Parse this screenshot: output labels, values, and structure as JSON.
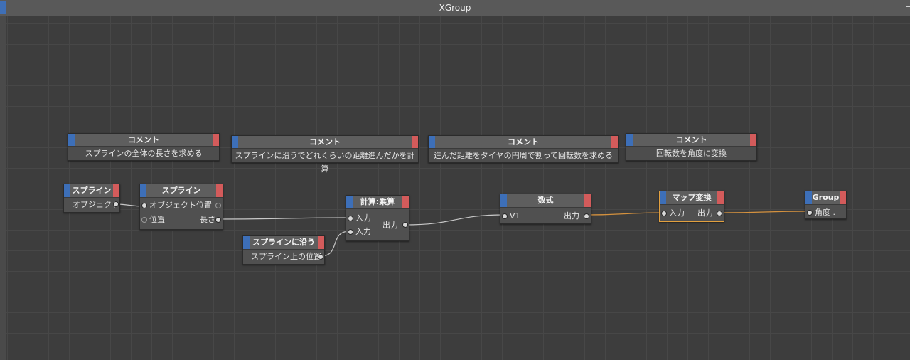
{
  "window": {
    "title": "XGroup"
  },
  "colors": {
    "port_left": "#3d6fb8",
    "port_right": "#d35b5b",
    "wire_data": "#c8c8c8",
    "wire_map": "#d4913e",
    "selected_border": "#e2a03f",
    "background": "#3d3d3d"
  },
  "comments": [
    {
      "title": "コメント",
      "text": "スプラインの全体の長さを求める"
    },
    {
      "title": "コメント",
      "text": "スプラインに沿うでどれくらいの距離進んだかを計算"
    },
    {
      "title": "コメント",
      "text": "進んだ距離をタイヤの円周で割って回転数を求める"
    },
    {
      "title": "コメント",
      "text": "回転数を角度に変換"
    }
  ],
  "nodes": {
    "spline_object": {
      "title": "スプライン",
      "out": "オブジェクト"
    },
    "spline_info": {
      "title": "スプライン",
      "in_object": "オブジェクト",
      "in_position": "位置",
      "out_position": "位置",
      "out_length": "長さ"
    },
    "along_spline": {
      "title": "スプラインに沿う",
      "out": "スプライン上の位置"
    },
    "multiply": {
      "title": "計算:乗算",
      "in1": "入力",
      "in2": "入力",
      "out": "出力"
    },
    "formula": {
      "title": "数式",
      "in": "V1",
      "out": "出力"
    },
    "range_mapper": {
      "title": "マップ変換",
      "in": "入力",
      "out": "出力"
    },
    "group": {
      "title": "Group",
      "in": "角度 ."
    }
  }
}
